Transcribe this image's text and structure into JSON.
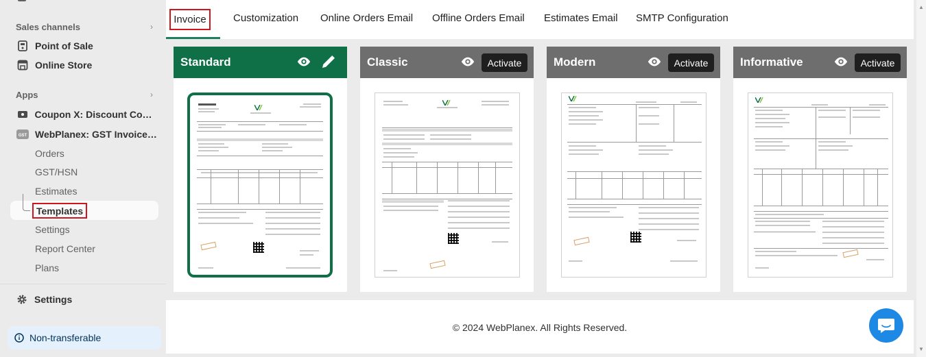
{
  "sidebar": {
    "sales_channels_label": "Sales channels",
    "sales_channels": [
      {
        "label": "Point of Sale",
        "icon": "pos-icon"
      },
      {
        "label": "Online Store",
        "icon": "store-icon"
      }
    ],
    "apps_label": "Apps",
    "apps": [
      {
        "label": "Coupon X: Discount Code...",
        "icon": "coupon-app-icon"
      },
      {
        "label": "WebPlanex: GST Invoice I...",
        "icon": "gst-app-icon",
        "icon_text": "GST"
      }
    ],
    "gst_subitems": [
      "Orders",
      "GST/HSN",
      "Estimates",
      "Templates",
      "Settings",
      "Report Center",
      "Plans"
    ],
    "active_subitem": "Templates",
    "settings_label": "Settings",
    "non_transferable_label": "Non-transferable"
  },
  "tabs": {
    "items": [
      "Invoice",
      "Customization",
      "Online Orders Email",
      "Offline Orders Email",
      "Estimates Email",
      "SMTP Configuration"
    ],
    "active": "Invoice"
  },
  "templates": [
    {
      "name": "Standard",
      "active": true,
      "actions": [
        "eye-icon",
        "pencil-icon"
      ]
    },
    {
      "name": "Classic",
      "active": false,
      "button": "Activate"
    },
    {
      "name": "Modern",
      "active": false,
      "button": "Activate"
    },
    {
      "name": "Informative",
      "active": false,
      "button": "Activate"
    }
  ],
  "preview_doc_title": "Tax Invoice",
  "footer_text": "© 2024 WebPlanex. All Rights Reserved.",
  "colors": {
    "brand_green": "#0f7048",
    "header_gray": "#6e6e6e",
    "highlight_red": "#d0161d",
    "chat_blue": "#1e88e5",
    "info_bg": "#e4f0fb"
  }
}
